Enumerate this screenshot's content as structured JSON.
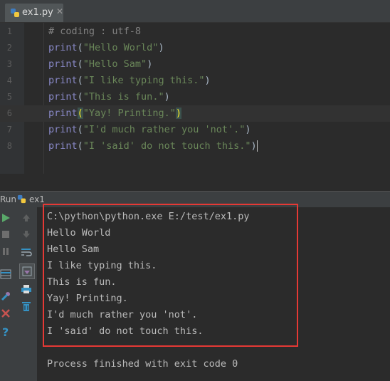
{
  "tab": {
    "filename": "ex1.py",
    "close": "✕"
  },
  "editor": {
    "lines": [
      {
        "num": "1",
        "comment": "# coding : utf-8"
      },
      {
        "num": "2",
        "fn": "print",
        "open": "(",
        "str": "\"Hello World\"",
        "close": ")"
      },
      {
        "num": "3",
        "fn": "print",
        "open": "(",
        "str": "\"Hello Sam\"",
        "close": ")"
      },
      {
        "num": "4",
        "fn": "print",
        "open": "(",
        "str": "\"I like typing this.\"",
        "close": ")"
      },
      {
        "num": "5",
        "fn": "print",
        "open": "(",
        "str": "\"This is fun.\"",
        "close": ")"
      },
      {
        "num": "6",
        "fn": "print",
        "open": "(",
        "str": "\"Yay! Printing.\"",
        "close": ")"
      },
      {
        "num": "7",
        "fn": "print",
        "open": "(",
        "str": "\"I'd much rather you 'not'.\"",
        "close": ")"
      },
      {
        "num": "8",
        "fn": "print",
        "open": "(",
        "str": "\"I 'said' do not touch this.\"",
        "close": ")"
      }
    ]
  },
  "run": {
    "label": "Run",
    "config": "ex1"
  },
  "console": {
    "lines": [
      "C:\\python\\python.exe E:/test/ex1.py",
      "Hello World",
      "Hello Sam",
      "I like typing this.",
      "This is fun.",
      "Yay! Printing.",
      "I'd much rather you 'not'.",
      "I 'said' do not touch this.",
      "",
      "Process finished with exit code 0"
    ]
  },
  "colors": {
    "highlight_box": "#e53935",
    "run_green": "#59a869",
    "stop_red": "#c75450",
    "help_blue": "#3592c4"
  }
}
